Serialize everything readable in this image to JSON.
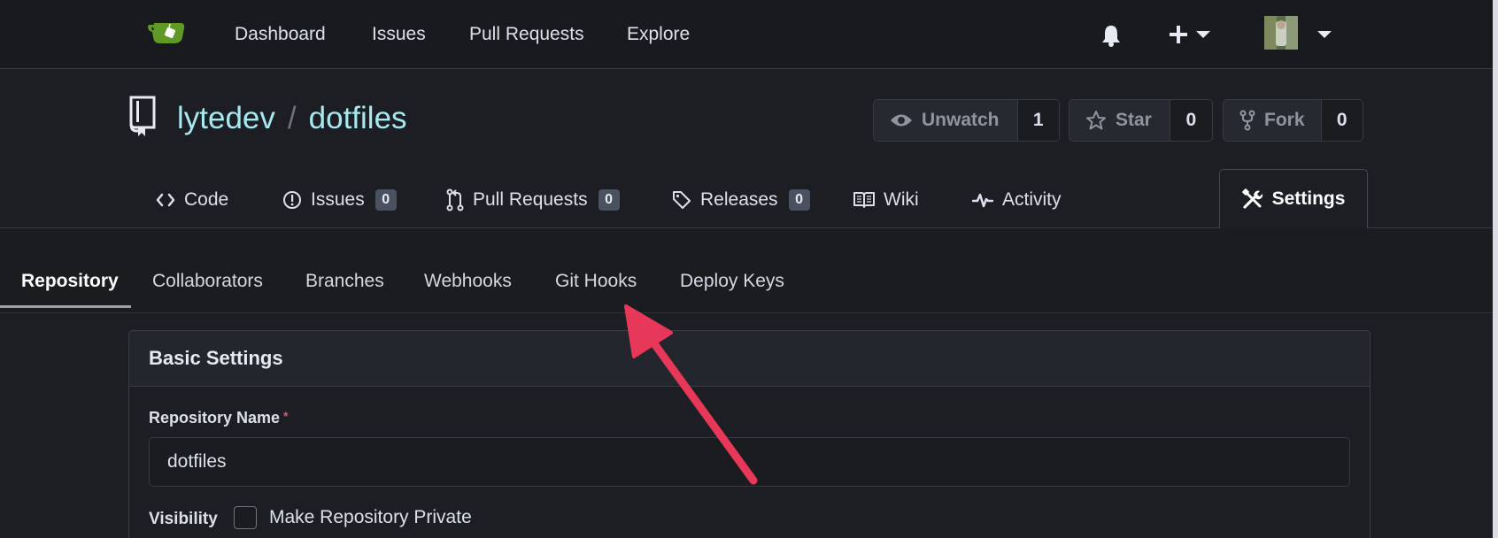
{
  "navbar": {
    "logo_icon": "gitea-teacup-logo",
    "links": [
      "Dashboard",
      "Issues",
      "Pull Requests",
      "Explore"
    ],
    "icons": [
      "bell-icon",
      "plus-icon",
      "caret-down-icon",
      "avatar",
      "caret-down-icon"
    ]
  },
  "repo": {
    "owner": "lytedev",
    "separator": "/",
    "name": "dotfiles",
    "watch": {
      "label": "Unwatch",
      "count": "1"
    },
    "star": {
      "label": "Star",
      "count": "0"
    },
    "fork": {
      "label": "Fork",
      "count": "0"
    }
  },
  "repo_tabs": {
    "code": "Code",
    "issues": {
      "label": "Issues",
      "count": "0"
    },
    "pulls": {
      "label": "Pull Requests",
      "count": "0"
    },
    "releases": {
      "label": "Releases",
      "count": "0"
    },
    "wiki": "Wiki",
    "activity": "Activity",
    "settings": "Settings"
  },
  "settings_nav": {
    "items": [
      "Repository",
      "Collaborators",
      "Branches",
      "Webhooks",
      "Git Hooks",
      "Deploy Keys"
    ],
    "active": "Repository"
  },
  "basic_settings": {
    "title": "Basic Settings",
    "name_label": "Repository Name",
    "required_mark": "*",
    "name_value": "dotfiles",
    "visibility_label": "Visibility",
    "private_label": "Make Repository Private",
    "private_checked": false
  },
  "colors": {
    "accent_link": "#a6e9f0",
    "logo_green": "#609926",
    "annotation_arrow": "#e8385a"
  }
}
